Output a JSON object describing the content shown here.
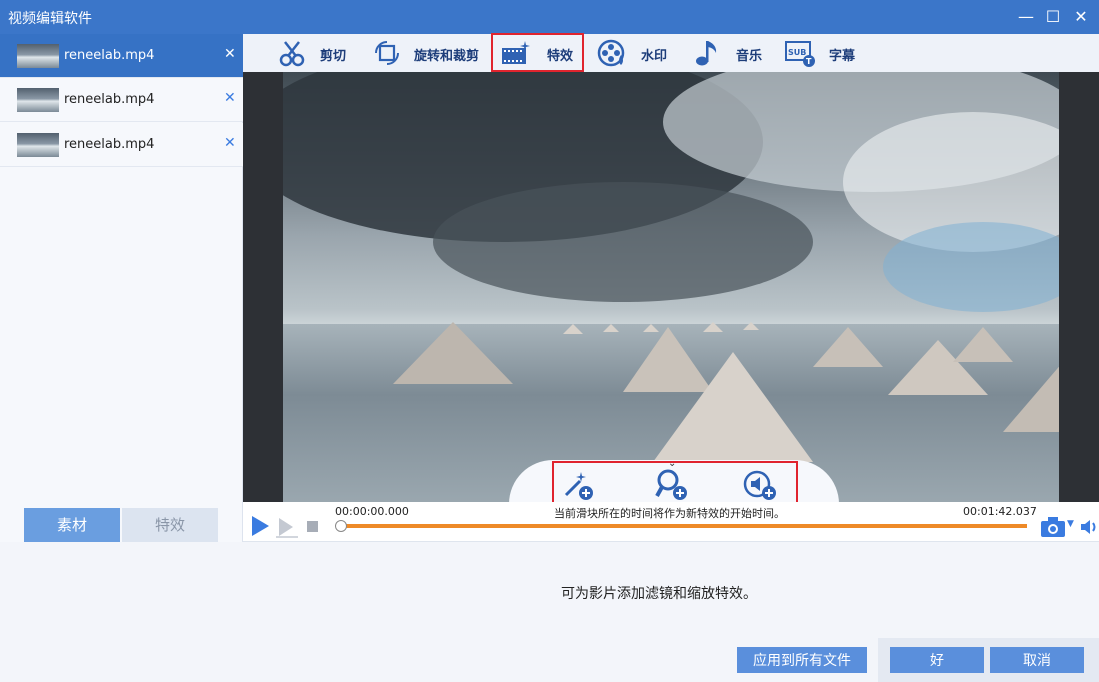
{
  "window": {
    "title": "视频编辑软件",
    "minimize_label": "—",
    "maximize_label": "☐",
    "close_label": "✕"
  },
  "files": [
    {
      "name": "reneelab.mp4",
      "close": "✕",
      "active": true
    },
    {
      "name": "reneelab.mp4",
      "close": "✕",
      "active": false
    },
    {
      "name": "reneelab.mp4",
      "close": "✕",
      "active": false
    }
  ],
  "left_tabs": {
    "material": "素材",
    "effects": "特效"
  },
  "toolbar": {
    "items": [
      {
        "label": "剪切",
        "icon": "scissors-icon"
      },
      {
        "label": "旋转和裁剪",
        "icon": "rotate-crop-icon"
      },
      {
        "label": "特效",
        "icon": "film-effects-icon"
      },
      {
        "label": "水印",
        "icon": "watermark-icon"
      },
      {
        "label": "音乐",
        "icon": "music-note-icon"
      },
      {
        "label": "字幕",
        "icon": "subtitle-icon"
      }
    ],
    "selected": "特效"
  },
  "preview": {
    "effect_icons": [
      "magic-wand-add-icon",
      "zoom-add-icon",
      "audio-add-icon"
    ]
  },
  "playback": {
    "time_start": "00:00:00.000",
    "time_end": "00:01:42.037",
    "hint": "当前滑块所在的时间将作为新特效的开始时间。",
    "progress": 0
  },
  "bottom": {
    "info": "可为影片添加滤镜和缩放特效。",
    "apply_all": "应用到所有文件",
    "ok": "好",
    "cancel": "取消"
  },
  "colors": {
    "titlebar": "#3b76c9",
    "accent": "#3672c5",
    "highlight": "#e0242e",
    "timeline": "#ee8a28"
  }
}
